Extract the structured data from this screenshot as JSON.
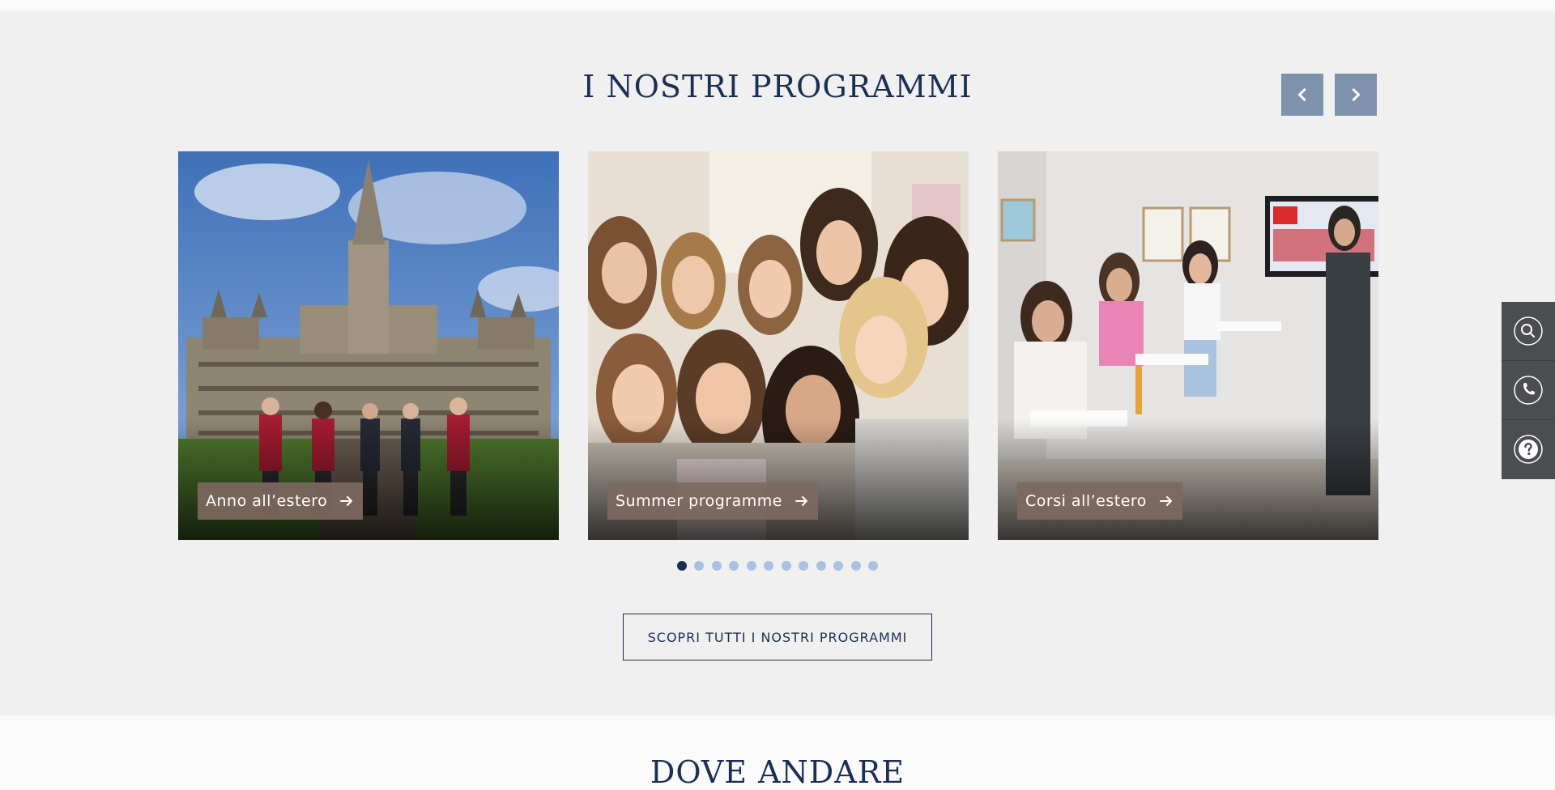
{
  "programs": {
    "title": "I NOSTRI PROGRAMMI",
    "cards": [
      {
        "label": "Anno all’estero",
        "image": "castle-school-students"
      },
      {
        "label": "Summer programme",
        "image": "group-of-girls-laughing"
      },
      {
        "label": "Corsi all’estero",
        "image": "classroom-lesson"
      }
    ],
    "pagination": {
      "total": 12,
      "active": 1
    },
    "cta_label": "SCOPRI TUTTI I NOSTRI PROGRAMMI"
  },
  "next_section": {
    "title": "DOVE ANDARE"
  },
  "side_tools": {
    "icons": [
      "search-icon",
      "phone-icon",
      "help-icon"
    ]
  },
  "colors": {
    "navy": "#1b2f55",
    "nav_button": "#7f92ab",
    "label_bg": "#7d695f",
    "dot_inactive": "#a9c1e2",
    "side_panel": "#4b4d50",
    "section_bg": "#f0f0f1"
  }
}
